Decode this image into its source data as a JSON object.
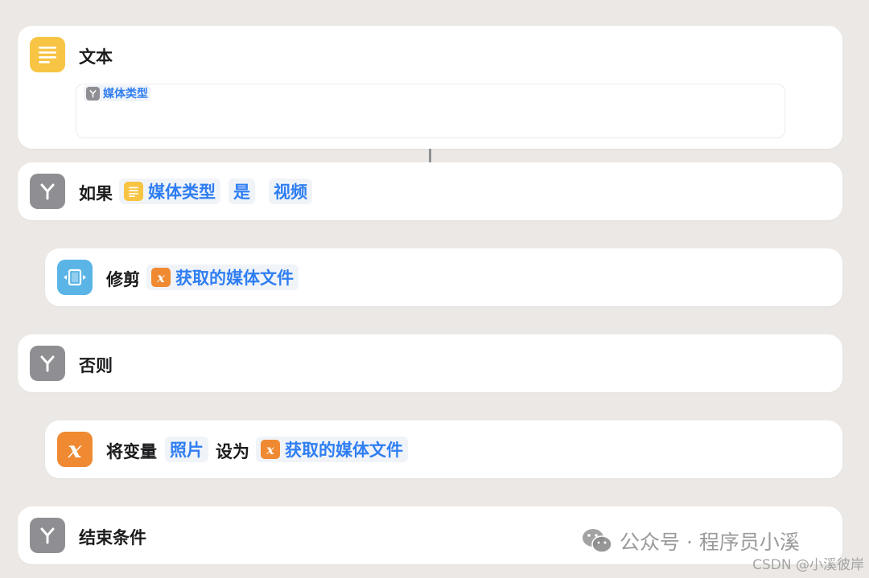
{
  "text_action": {
    "title": "文本",
    "icon": "text-lines-icon",
    "variable_token": "媒体类型"
  },
  "if_action": {
    "title": "如果",
    "icon": "branch-icon",
    "condition_var": "媒体类型",
    "operator": "是",
    "value": "视频"
  },
  "trim_action": {
    "title": "修剪",
    "icon": "trim-video-icon",
    "input_var": "获取的媒体文件"
  },
  "otherwise_action": {
    "title": "否则",
    "icon": "branch-icon"
  },
  "set_variable_action": {
    "title_prefix": "将变量",
    "variable_name": "照片",
    "title_middle": "设为",
    "value_var": "获取的媒体文件",
    "icon": "variable-x-icon",
    "icon_glyph": "x"
  },
  "end_if_action": {
    "title": "结束条件",
    "icon": "branch-icon"
  },
  "watermark": {
    "text": "公众号 · 程序员小溪",
    "csdn": "CSDN @小溪彼岸"
  },
  "colors": {
    "background": "#ebe8e5",
    "token_blue": "#2f7ef3",
    "icon_yellow": "#f8c444",
    "icon_gray": "#8e8e93",
    "icon_blue": "#5ab4e6",
    "icon_orange": "#ef8a32"
  }
}
